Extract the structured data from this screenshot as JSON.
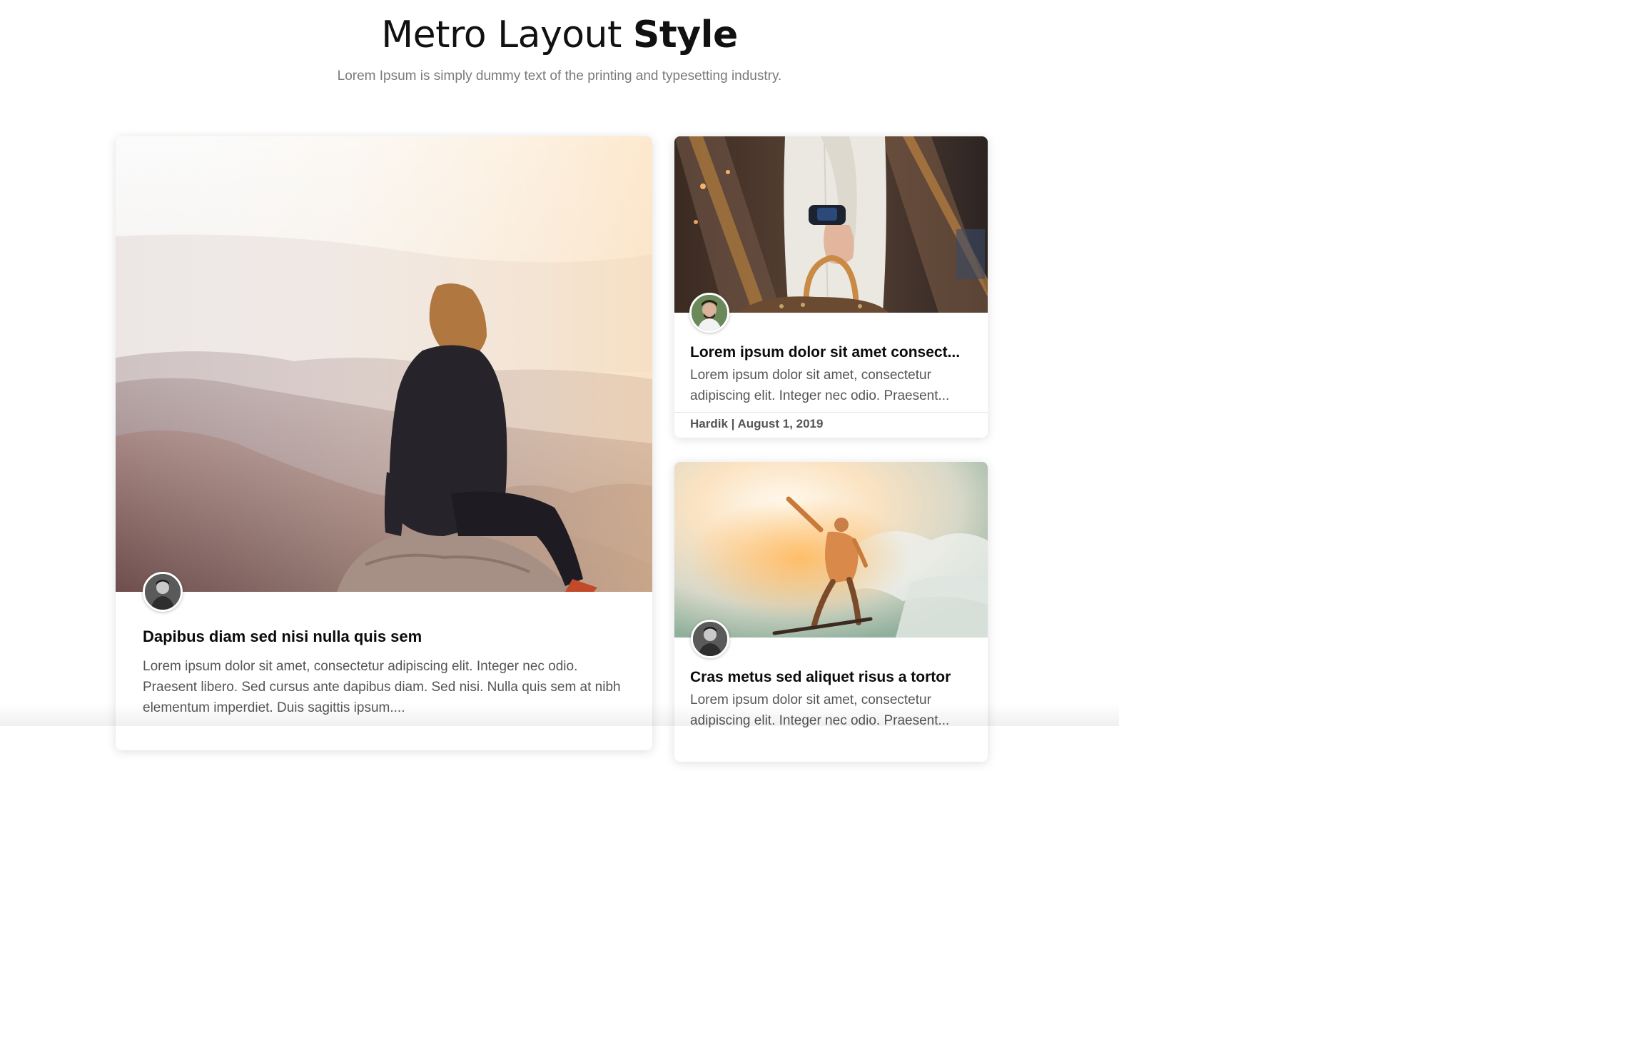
{
  "header": {
    "title_light": "Metro Layout",
    "title_bold": "Style",
    "subtitle": "Lorem Ipsum is simply dummy text of the printing and typesetting industry."
  },
  "cards": [
    {
      "image_icon": "mountain-woman-photo",
      "avatar_icon": "author-avatar",
      "title": "Dapibus diam sed nisi nulla quis sem",
      "text": "Lorem ipsum dolor sit amet, consectetur adipiscing elit. Integer nec odio. Praesent libero. Sed cursus ante dapibus diam. Sed nisi. Nulla quis sem at nibh elementum imperdiet. Duis sagittis ipsum...."
    },
    {
      "image_icon": "handbag-photo",
      "avatar_icon": "author-avatar",
      "title": "Lorem ipsum dolor sit amet consect...",
      "text": "Lorem ipsum dolor sit amet, consectetur\nadipiscing elit. Integer nec odio. Praesent...",
      "meta": "Hardik | August 1, 2019"
    },
    {
      "image_icon": "skateboard-jump-photo",
      "avatar_icon": "author-avatar",
      "title": "Cras metus sed aliquet risus a tortor",
      "text": "Lorem ipsum dolor sit amet, consectetur\nadipiscing elit. Integer nec odio. Praesent..."
    }
  ]
}
